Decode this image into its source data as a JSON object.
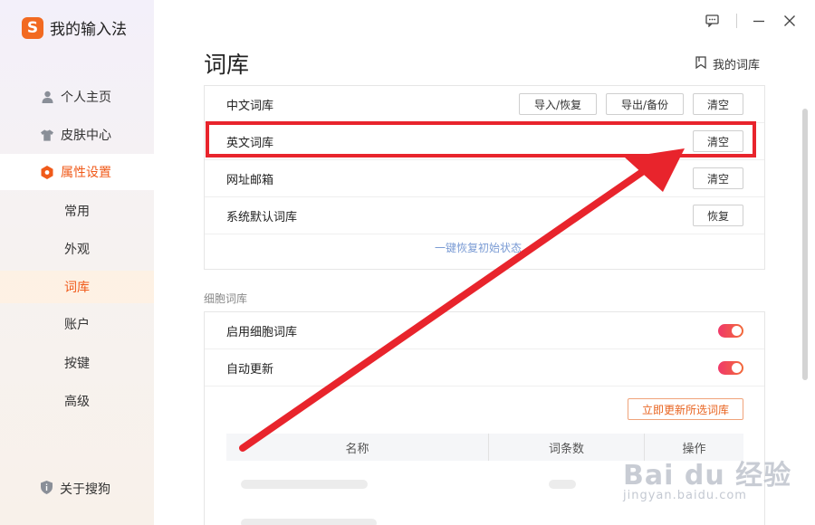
{
  "app": {
    "title": "我的输入法",
    "logo_letter": "S",
    "accent": "#f05a1a"
  },
  "sidebar": {
    "items": [
      {
        "label": "个人主页",
        "icon": "person-icon"
      },
      {
        "label": "皮肤中心",
        "icon": "tshirt-icon"
      },
      {
        "label": "属性设置",
        "icon": "hexagon-icon",
        "active": true
      }
    ],
    "sub_items": [
      {
        "label": "常用"
      },
      {
        "label": "外观"
      },
      {
        "label": "词库",
        "active": true
      },
      {
        "label": "账户"
      },
      {
        "label": "按键"
      },
      {
        "label": "高级"
      }
    ],
    "about": "关于搜狗"
  },
  "header": {
    "title": "词库",
    "my_dict": "我的词库"
  },
  "dict_card": {
    "rows": [
      {
        "label": "中文词库",
        "buttons": [
          "导入/恢复",
          "导出/备份",
          "清空"
        ]
      },
      {
        "label": "英文词库",
        "buttons": [
          "清空"
        ]
      },
      {
        "label": "网址邮箱",
        "buttons": [
          "清空"
        ]
      },
      {
        "label": "系统默认词库",
        "buttons": [
          "恢复"
        ]
      }
    ],
    "restore_all": "一键恢复初始状态"
  },
  "cell_section": {
    "label": "细胞词库",
    "rows": [
      {
        "label": "启用细胞词库",
        "toggle_on": true
      },
      {
        "label": "自动更新",
        "toggle_on": true
      }
    ],
    "update_button": "立即更新所选词库",
    "table_headers": [
      "名称",
      "词条数",
      "操作"
    ]
  },
  "watermark": {
    "main": "Bai du 经验",
    "sub": "jingyan.baidu.com"
  },
  "colors": {
    "highlight": "#e8242c",
    "toggle": "#f0396a"
  }
}
